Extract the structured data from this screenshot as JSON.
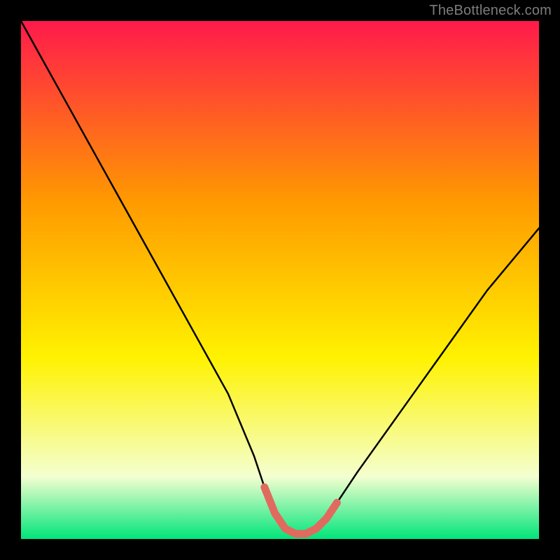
{
  "watermark": "TheBottleneck.com",
  "chart_data": {
    "type": "line",
    "title": "",
    "xlabel": "",
    "ylabel": "",
    "xlim": [
      0,
      100
    ],
    "ylim": [
      0,
      100
    ],
    "grid": false,
    "legend": false,
    "background_gradient": {
      "top": "#ff1a4b",
      "mid1": "#ff9a00",
      "mid2": "#fff200",
      "mid3": "#f4ffd0",
      "bottom": "#00e57a"
    },
    "series": [
      {
        "name": "bottleneck-curve",
        "stroke": "#000000",
        "x": [
          0,
          5,
          10,
          15,
          20,
          25,
          30,
          35,
          40,
          45,
          47,
          49,
          51,
          53,
          55,
          57,
          59,
          61,
          65,
          70,
          75,
          80,
          85,
          90,
          95,
          100
        ],
        "values": [
          100,
          91,
          82,
          73,
          64,
          55,
          46,
          37,
          28,
          16,
          10,
          5,
          2,
          1,
          1,
          2,
          4,
          7,
          13,
          20,
          27,
          34,
          41,
          48,
          54,
          60
        ]
      },
      {
        "name": "valley-highlight",
        "stroke": "#e16a5f",
        "x": [
          47,
          49,
          51,
          53,
          55,
          57,
          59,
          61
        ],
        "values": [
          10,
          5,
          2,
          1,
          1,
          2,
          4,
          7
        ]
      }
    ]
  }
}
